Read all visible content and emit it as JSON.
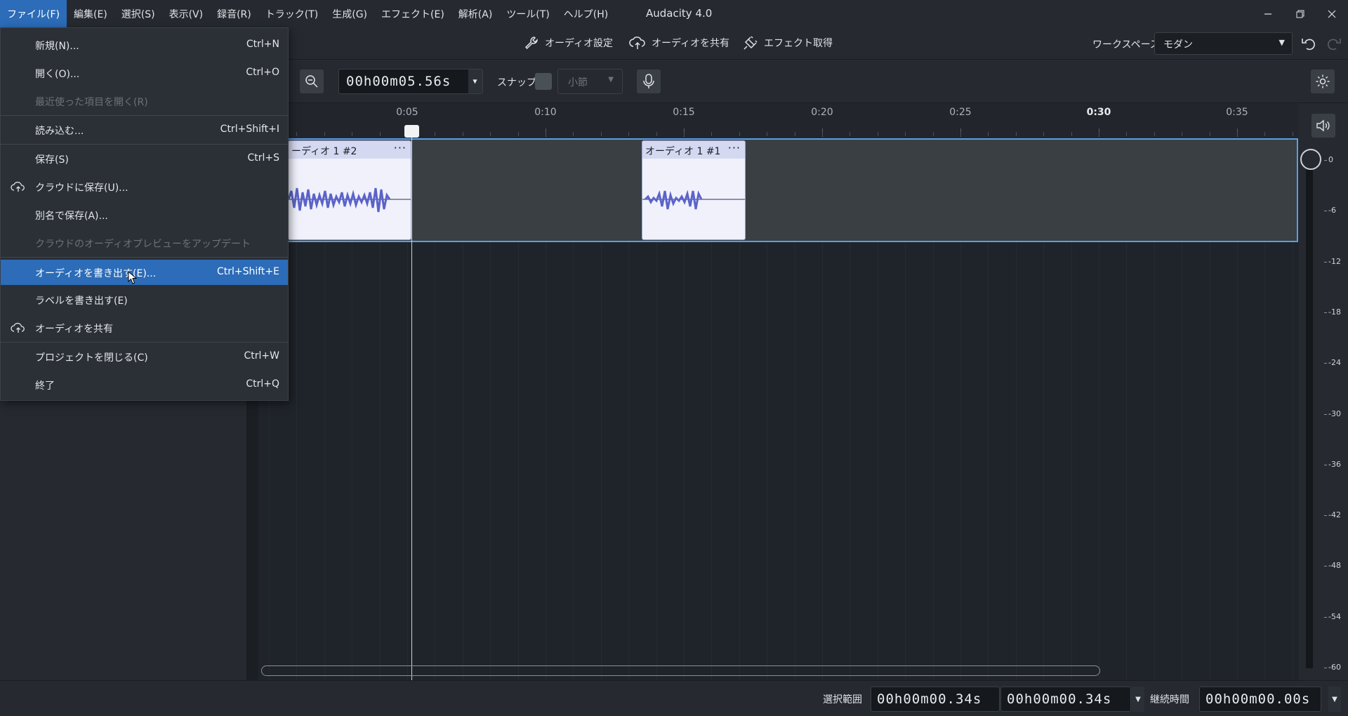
{
  "app": {
    "title": "Audacity 4.0"
  },
  "menubar": [
    "ファイル(F)",
    "編集(E)",
    "選択(S)",
    "表示(V)",
    "録音(R)",
    "トラック(T)",
    "生成(G)",
    "エフェクト(E)",
    "解析(A)",
    "ツール(T)",
    "ヘルプ(H)"
  ],
  "toolbar": {
    "audio_settings": "オーディオ設定",
    "share_audio": "オーディオを共有",
    "get_effects": "エフェクト取得",
    "workspace_label": "ワークスペース",
    "workspace_value": "モダン"
  },
  "toolbar2": {
    "timecode": "00h00m05.56s",
    "snap_label": "スナップ",
    "snap_value": "小節"
  },
  "ruler": {
    "labels": [
      "0:05",
      "0:10",
      "0:15",
      "0:20",
      "0:25",
      "0:30",
      "0:35"
    ]
  },
  "clips": [
    {
      "name": "ーディオ 1 #2"
    },
    {
      "name": "オーディオ 1 #1"
    }
  ],
  "meter": {
    "labels": [
      "0",
      "-6",
      "-12",
      "-18",
      "-24",
      "-30",
      "-36",
      "-42",
      "-48",
      "-54",
      "-60"
    ]
  },
  "status": {
    "selection_label": "選択範囲",
    "selection_start": "00h00m00.34s",
    "selection_end": "00h00m00.34s",
    "duration_label": "継続時間",
    "duration": "00h00m00.00s"
  },
  "file_menu": {
    "items": [
      {
        "label": "新規(N)...",
        "shortcut": "Ctrl+N"
      },
      {
        "label": "開く(O)...",
        "shortcut": "Ctrl+O"
      },
      {
        "label": "最近使った項目を開く(R)",
        "shortcut": ""
      },
      {
        "label": "読み込む...",
        "shortcut": "Ctrl+Shift+I"
      },
      {
        "label": "保存(S)",
        "shortcut": "Ctrl+S"
      },
      {
        "label": "クラウドに保存(U)...",
        "shortcut": ""
      },
      {
        "label": "別名で保存(A)...",
        "shortcut": ""
      },
      {
        "label": "クラウドのオーディオプレビューをアップデート",
        "shortcut": ""
      },
      {
        "label": "オーディオを書き出す(E)...",
        "shortcut": "Ctrl+Shift+E"
      },
      {
        "label": "ラベルを書き出す(E)",
        "shortcut": ""
      },
      {
        "label": "オーディオを共有",
        "shortcut": ""
      },
      {
        "label": "プロジェクトを閉じる(C)",
        "shortcut": "Ctrl+W"
      },
      {
        "label": "終了",
        "shortcut": "Ctrl+Q"
      }
    ]
  },
  "icons": [
    "wrench-icon",
    "cloud-share-icon",
    "plug-icon",
    "undo-icon",
    "redo-icon",
    "zoom-out-icon",
    "mic-icon",
    "gear-icon",
    "speaker-icon",
    "cloud-icon",
    "cursor-icon"
  ],
  "colors": {
    "accent": "#2c6cb8",
    "selection_border": "#5b9ee6",
    "waveform": "#5b63c9"
  }
}
